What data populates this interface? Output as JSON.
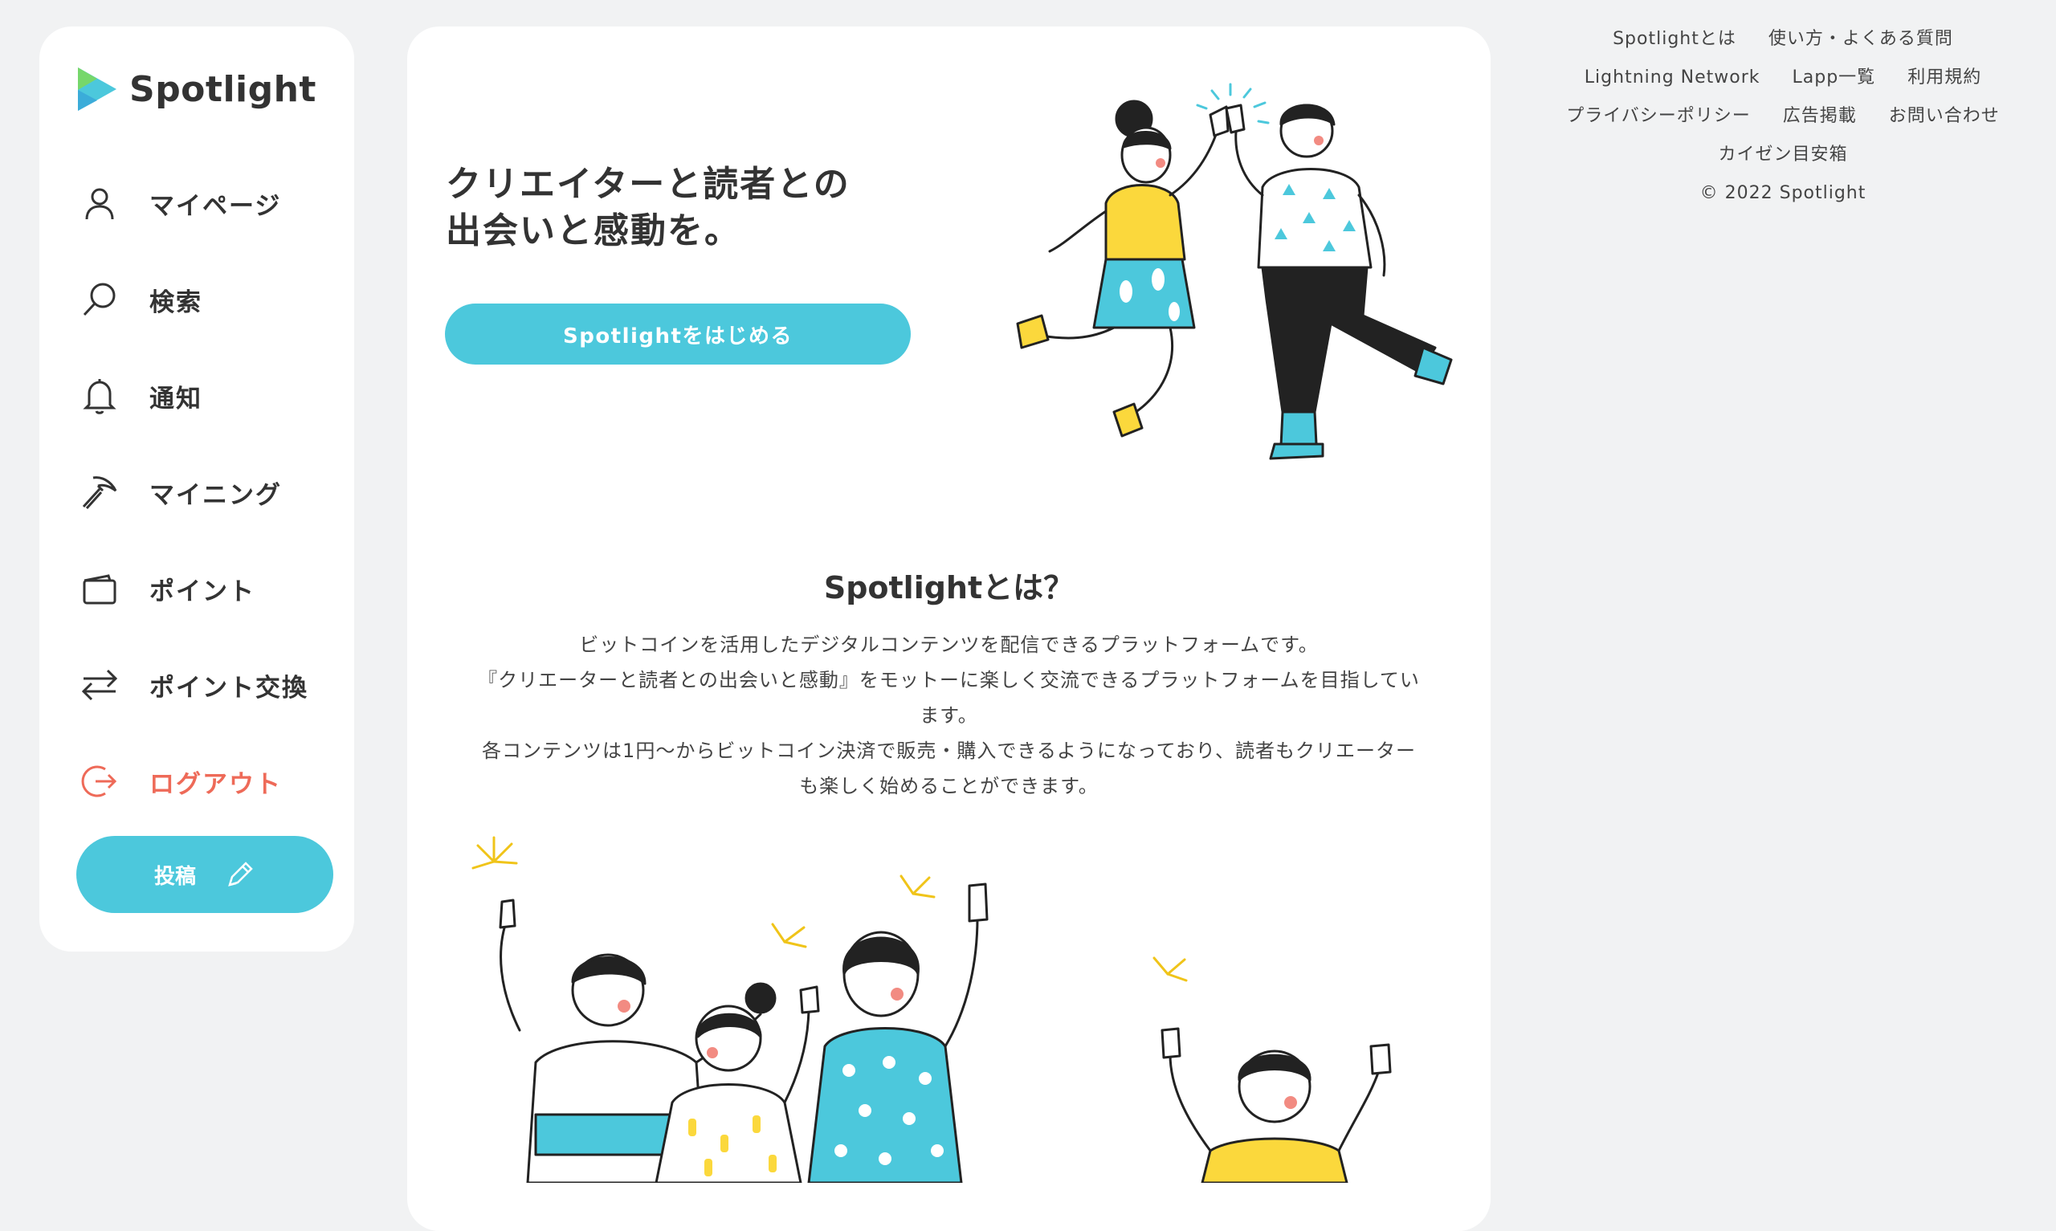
{
  "brand": {
    "name": "Spotlight",
    "accent": "#4cc8dc",
    "logout_color": "#ee6a58"
  },
  "sidebar": {
    "items": [
      {
        "label": "マイページ",
        "icon": "person-icon"
      },
      {
        "label": "検索",
        "icon": "search-icon"
      },
      {
        "label": "通知",
        "icon": "bell-icon"
      },
      {
        "label": "マイニング",
        "icon": "pickaxe-icon"
      },
      {
        "label": "ポイント",
        "icon": "wallet-icon"
      },
      {
        "label": "ポイント交換",
        "icon": "exchange-icon"
      },
      {
        "label": "ログアウト",
        "icon": "logout-icon"
      }
    ],
    "post_label": "投稿"
  },
  "hero": {
    "title_line1": "クリエイターと読者との",
    "title_line2": "出会いと感動を。",
    "cta_label": "Spotlightをはじめる"
  },
  "about": {
    "title": "Spotlightとは？",
    "line1": "ビットコインを活用したデジタルコンテンツを配信できるプラットフォームです。",
    "line2": "『クリエーターと読者との出会いと感動』をモットーに楽しく交流できるプラットフォームを目指してい",
    "line3": "ます。",
    "line4": "各コンテンツは1円〜からビットコイン決済で販売・購入できるようになっており、読者もクリエーター",
    "line5": "も楽しく始めることができます。"
  },
  "footer": {
    "about": "Spotlightとは",
    "faq": "使い方・よくある質問",
    "lightning": "Lightning Network",
    "lapp": "Lapp一覧",
    "terms": "利用規約",
    "privacy": "プライバシーポリシー",
    "ads": "広告掲載",
    "contact": "お問い合わせ",
    "kaizen": "カイゼン目安箱",
    "copyright": "© 2022 Spotlight"
  }
}
